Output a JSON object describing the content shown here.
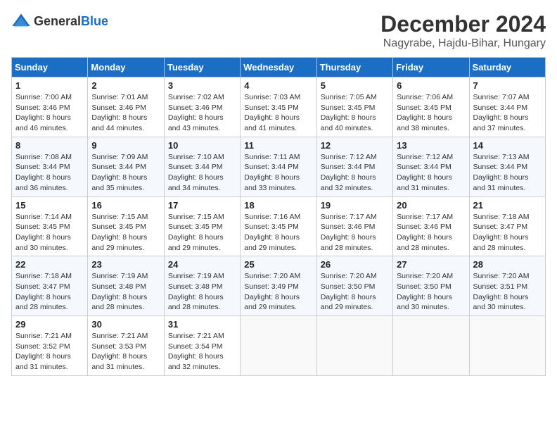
{
  "logo": {
    "text_general": "General",
    "text_blue": "Blue"
  },
  "title": {
    "month": "December 2024",
    "location": "Nagyrabe, Hajdu-Bihar, Hungary"
  },
  "weekdays": [
    "Sunday",
    "Monday",
    "Tuesday",
    "Wednesday",
    "Thursday",
    "Friday",
    "Saturday"
  ],
  "weeks": [
    [
      {
        "day": "1",
        "sunrise": "Sunrise: 7:00 AM",
        "sunset": "Sunset: 3:46 PM",
        "daylight": "Daylight: 8 hours and 46 minutes."
      },
      {
        "day": "2",
        "sunrise": "Sunrise: 7:01 AM",
        "sunset": "Sunset: 3:46 PM",
        "daylight": "Daylight: 8 hours and 44 minutes."
      },
      {
        "day": "3",
        "sunrise": "Sunrise: 7:02 AM",
        "sunset": "Sunset: 3:46 PM",
        "daylight": "Daylight: 8 hours and 43 minutes."
      },
      {
        "day": "4",
        "sunrise": "Sunrise: 7:03 AM",
        "sunset": "Sunset: 3:45 PM",
        "daylight": "Daylight: 8 hours and 41 minutes."
      },
      {
        "day": "5",
        "sunrise": "Sunrise: 7:05 AM",
        "sunset": "Sunset: 3:45 PM",
        "daylight": "Daylight: 8 hours and 40 minutes."
      },
      {
        "day": "6",
        "sunrise": "Sunrise: 7:06 AM",
        "sunset": "Sunset: 3:45 PM",
        "daylight": "Daylight: 8 hours and 38 minutes."
      },
      {
        "day": "7",
        "sunrise": "Sunrise: 7:07 AM",
        "sunset": "Sunset: 3:44 PM",
        "daylight": "Daylight: 8 hours and 37 minutes."
      }
    ],
    [
      {
        "day": "8",
        "sunrise": "Sunrise: 7:08 AM",
        "sunset": "Sunset: 3:44 PM",
        "daylight": "Daylight: 8 hours and 36 minutes."
      },
      {
        "day": "9",
        "sunrise": "Sunrise: 7:09 AM",
        "sunset": "Sunset: 3:44 PM",
        "daylight": "Daylight: 8 hours and 35 minutes."
      },
      {
        "day": "10",
        "sunrise": "Sunrise: 7:10 AM",
        "sunset": "Sunset: 3:44 PM",
        "daylight": "Daylight: 8 hours and 34 minutes."
      },
      {
        "day": "11",
        "sunrise": "Sunrise: 7:11 AM",
        "sunset": "Sunset: 3:44 PM",
        "daylight": "Daylight: 8 hours and 33 minutes."
      },
      {
        "day": "12",
        "sunrise": "Sunrise: 7:12 AM",
        "sunset": "Sunset: 3:44 PM",
        "daylight": "Daylight: 8 hours and 32 minutes."
      },
      {
        "day": "13",
        "sunrise": "Sunrise: 7:12 AM",
        "sunset": "Sunset: 3:44 PM",
        "daylight": "Daylight: 8 hours and 31 minutes."
      },
      {
        "day": "14",
        "sunrise": "Sunrise: 7:13 AM",
        "sunset": "Sunset: 3:44 PM",
        "daylight": "Daylight: 8 hours and 31 minutes."
      }
    ],
    [
      {
        "day": "15",
        "sunrise": "Sunrise: 7:14 AM",
        "sunset": "Sunset: 3:45 PM",
        "daylight": "Daylight: 8 hours and 30 minutes."
      },
      {
        "day": "16",
        "sunrise": "Sunrise: 7:15 AM",
        "sunset": "Sunset: 3:45 PM",
        "daylight": "Daylight: 8 hours and 29 minutes."
      },
      {
        "day": "17",
        "sunrise": "Sunrise: 7:15 AM",
        "sunset": "Sunset: 3:45 PM",
        "daylight": "Daylight: 8 hours and 29 minutes."
      },
      {
        "day": "18",
        "sunrise": "Sunrise: 7:16 AM",
        "sunset": "Sunset: 3:45 PM",
        "daylight": "Daylight: 8 hours and 29 minutes."
      },
      {
        "day": "19",
        "sunrise": "Sunrise: 7:17 AM",
        "sunset": "Sunset: 3:46 PM",
        "daylight": "Daylight: 8 hours and 28 minutes."
      },
      {
        "day": "20",
        "sunrise": "Sunrise: 7:17 AM",
        "sunset": "Sunset: 3:46 PM",
        "daylight": "Daylight: 8 hours and 28 minutes."
      },
      {
        "day": "21",
        "sunrise": "Sunrise: 7:18 AM",
        "sunset": "Sunset: 3:47 PM",
        "daylight": "Daylight: 8 hours and 28 minutes."
      }
    ],
    [
      {
        "day": "22",
        "sunrise": "Sunrise: 7:18 AM",
        "sunset": "Sunset: 3:47 PM",
        "daylight": "Daylight: 8 hours and 28 minutes."
      },
      {
        "day": "23",
        "sunrise": "Sunrise: 7:19 AM",
        "sunset": "Sunset: 3:48 PM",
        "daylight": "Daylight: 8 hours and 28 minutes."
      },
      {
        "day": "24",
        "sunrise": "Sunrise: 7:19 AM",
        "sunset": "Sunset: 3:48 PM",
        "daylight": "Daylight: 8 hours and 28 minutes."
      },
      {
        "day": "25",
        "sunrise": "Sunrise: 7:20 AM",
        "sunset": "Sunset: 3:49 PM",
        "daylight": "Daylight: 8 hours and 29 minutes."
      },
      {
        "day": "26",
        "sunrise": "Sunrise: 7:20 AM",
        "sunset": "Sunset: 3:50 PM",
        "daylight": "Daylight: 8 hours and 29 minutes."
      },
      {
        "day": "27",
        "sunrise": "Sunrise: 7:20 AM",
        "sunset": "Sunset: 3:50 PM",
        "daylight": "Daylight: 8 hours and 30 minutes."
      },
      {
        "day": "28",
        "sunrise": "Sunrise: 7:20 AM",
        "sunset": "Sunset: 3:51 PM",
        "daylight": "Daylight: 8 hours and 30 minutes."
      }
    ],
    [
      {
        "day": "29",
        "sunrise": "Sunrise: 7:21 AM",
        "sunset": "Sunset: 3:52 PM",
        "daylight": "Daylight: 8 hours and 31 minutes."
      },
      {
        "day": "30",
        "sunrise": "Sunrise: 7:21 AM",
        "sunset": "Sunset: 3:53 PM",
        "daylight": "Daylight: 8 hours and 31 minutes."
      },
      {
        "day": "31",
        "sunrise": "Sunrise: 7:21 AM",
        "sunset": "Sunset: 3:54 PM",
        "daylight": "Daylight: 8 hours and 32 minutes."
      },
      null,
      null,
      null,
      null
    ]
  ]
}
